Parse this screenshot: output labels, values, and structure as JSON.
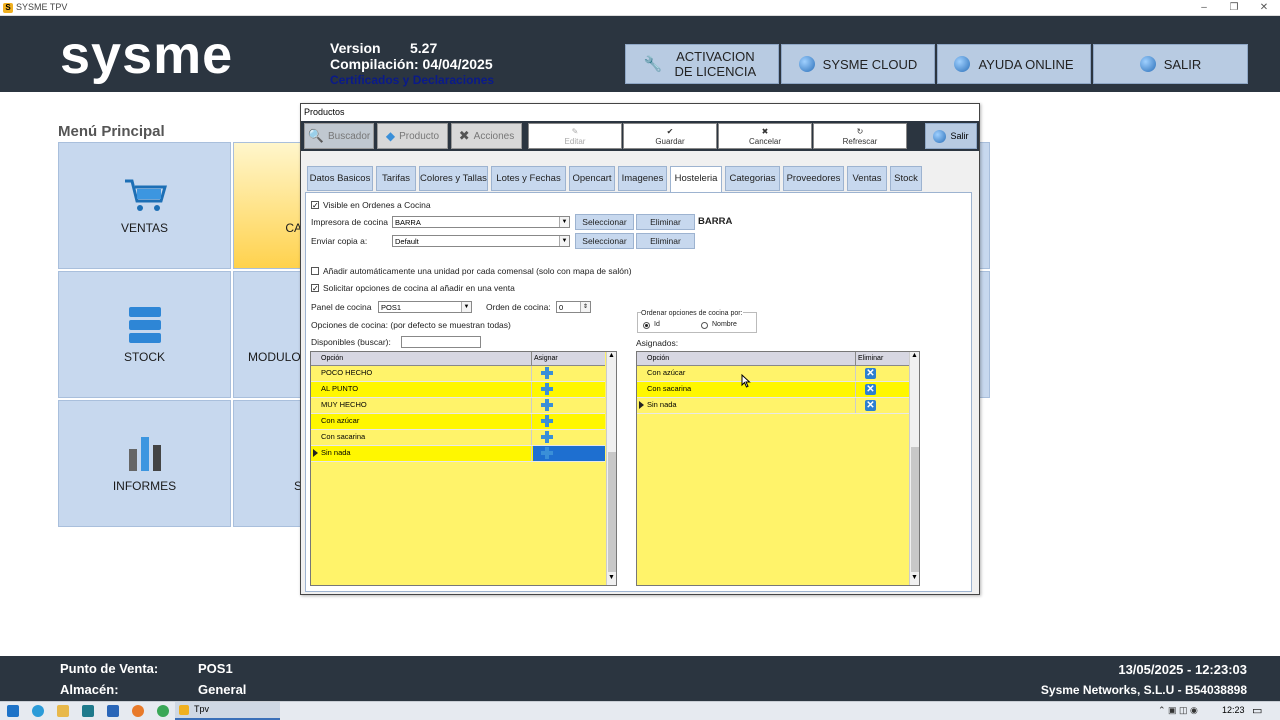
{
  "window": {
    "title": "SYSME TPV"
  },
  "header": {
    "logo": "sysme",
    "version_label": "Version",
    "version_value": "5.27",
    "compilation": "Compilación: 04/04/2025",
    "certs_link": "Certificados y Declaraciones",
    "buttons": {
      "activation": "ACTIVACION DE LICENCIA",
      "cloud": "SYSME CLOUD",
      "help": "AYUDA ONLINE",
      "exit": "SALIR"
    }
  },
  "menu": {
    "title": "Menú Principal",
    "tiles": {
      "ventas": "VENTAS",
      "ca": "CA",
      "stock": "STOCK",
      "modulos": "MODULO",
      "informes": "INFORMES",
      "s": "S"
    }
  },
  "dialog": {
    "title": "Productos",
    "toolbar": {
      "buscador": "Buscador",
      "producto": "Producto",
      "acciones": "Acciones",
      "editar": "Editar",
      "guardar": "Guardar",
      "cancelar": "Cancelar",
      "refrescar": "Refrescar",
      "salir": "Salir"
    },
    "tabs": [
      "Datos Basicos",
      "Tarifas",
      "Colores y Tallas",
      "Lotes y Fechas",
      "Opencart",
      "Imagenes",
      "Hosteleria",
      "Categorias",
      "Proveedores",
      "Ventas",
      "Stock"
    ],
    "active_tab": "Hosteleria",
    "hosteleria": {
      "visible_label": "Visible en Ordenes a Cocina",
      "visible_checked": true,
      "impresora_label": "Impresora de cocina",
      "impresora_value": "BARRA",
      "impresora_display": "BARRA",
      "copia_label": "Enviar copia a:",
      "copia_value": "Default",
      "seleccionar": "Seleccionar",
      "eliminar": "Eliminar",
      "auto_label": "Añadir automáticamente una unidad por cada comensal (solo con mapa de salón)",
      "auto_checked": false,
      "solicitar_label": "Solicitar opciones de cocina al añadir en una venta",
      "solicitar_checked": true,
      "panel_label": "Panel de cocina",
      "panel_value": "POS1",
      "orden_label": "Orden de cocina:",
      "orden_value": "0",
      "opciones_label": "Opciones de cocina: (por defecto se muestran todas)",
      "disponibles_label": "Disponibles (buscar):",
      "disponibles_search": "",
      "ordenar_label": "Ordenar opciones de cocina por:",
      "ordenar_id": "Id",
      "ordenar_nombre": "Nombre",
      "ordenar_selected": "Id",
      "asignados_label": "Asignados:",
      "disp_headers": {
        "opcion": "Opción",
        "asignar": "Asignar"
      },
      "disponibles": [
        "POCO HECHO",
        "AL PUNTO",
        "MUY HECHO",
        "Con azúcar",
        "Con sacarina",
        "Sin nada"
      ],
      "asig_headers": {
        "opcion": "Opción",
        "eliminar": "Eliminar"
      },
      "asignados": [
        "Con azúcar",
        "Con sacarina",
        "Sin nada"
      ]
    }
  },
  "footer": {
    "pv_label": "Punto de Venta:",
    "pv_value": "POS1",
    "alm_label": "Almacén:",
    "alm_value": "General",
    "datetime": "13/05/2025 - 12:23:03",
    "company": "Sysme Networks, S.L.U - B54038898"
  },
  "taskbar": {
    "app": "Tpv",
    "clock": "12:23"
  }
}
